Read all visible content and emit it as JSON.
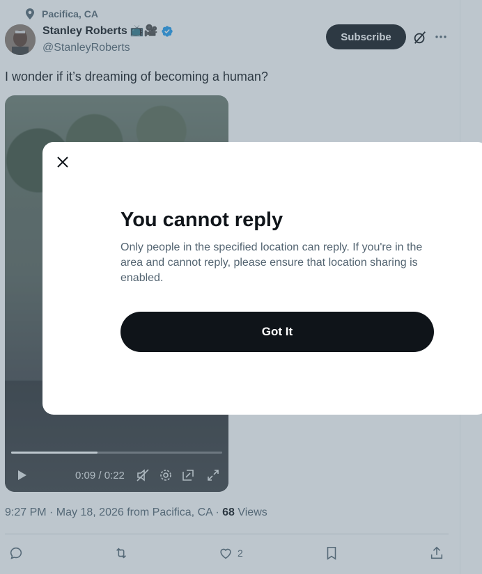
{
  "tweet": {
    "location": "Pacifica, CA",
    "author_name": "Stanley Roberts",
    "name_emojis": "📺🎥",
    "handle": "@StanleyRoberts",
    "subscribe_label": "Subscribe",
    "text": "I wonder if it’s dreaming of becoming a human?",
    "video": {
      "time_display": "0:09 / 0:22",
      "progress_fraction": 0.41
    },
    "meta": {
      "timestamp": "9:27 PM · May 18, 2026 from Pacifica, CA · ",
      "views_count": "68",
      "views_label": " Views"
    },
    "actions": {
      "like_count": "2"
    }
  },
  "modal": {
    "title": "You cannot reply",
    "body": "Only people in the specified location can reply. If you're in the area and cannot reply, please ensure that location sharing is enabled.",
    "button_label": "Got It"
  },
  "colors": {
    "text_primary": "#0f1419",
    "text_secondary": "#536471",
    "verified_blue": "#1d9bf0",
    "overlay": "rgba(91,112,131,0.4)"
  },
  "icons": [
    "location-pin-icon",
    "verified-badge-icon",
    "grok-icon",
    "more-icon",
    "play-icon",
    "mute-icon",
    "settings-icon",
    "pip-icon",
    "fullscreen-icon",
    "close-icon",
    "reply-icon",
    "retweet-icon",
    "like-icon",
    "bookmark-icon",
    "share-icon"
  ]
}
